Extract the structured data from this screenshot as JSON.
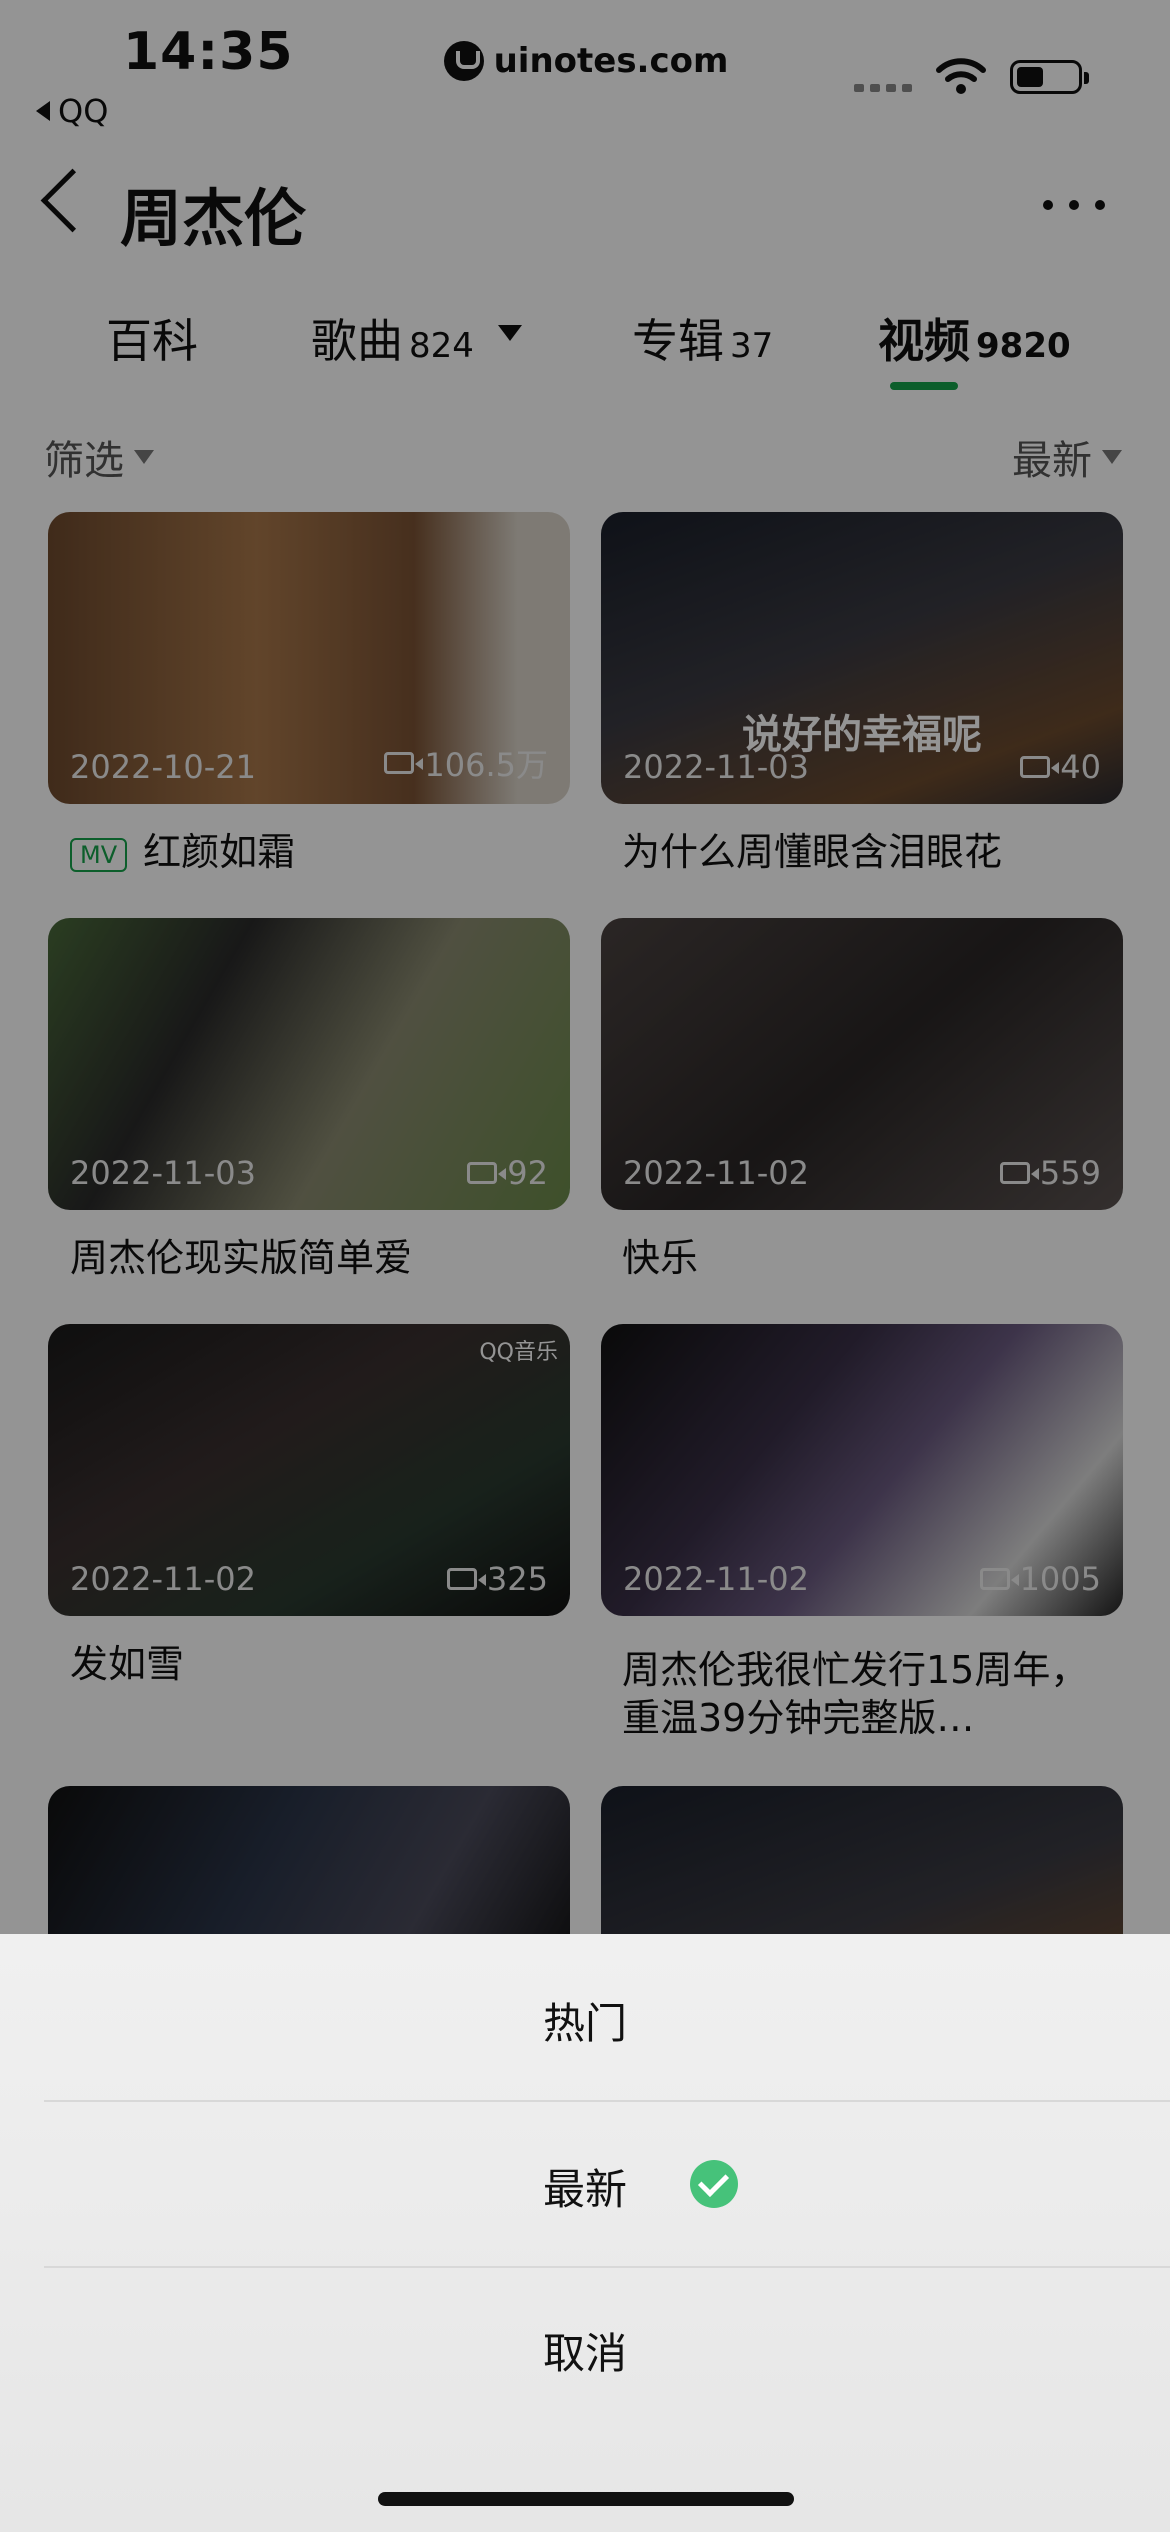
{
  "status_bar": {
    "time": "14:35",
    "back_label": "QQ",
    "url": "uinotes.com"
  },
  "header": {
    "title": "周杰伦"
  },
  "tabs": [
    {
      "label": "百科",
      "count": ""
    },
    {
      "label": "歌曲",
      "count": "824"
    },
    {
      "label": "专辑",
      "count": "37"
    },
    {
      "label": "视频",
      "count": "9820"
    }
  ],
  "filter": {
    "label": "筛选",
    "sort_label": "最新"
  },
  "videos": [
    {
      "date": "2022-10-21",
      "views": "106.5万",
      "badge": "MV",
      "title": "红颜如霜",
      "overlay": ""
    },
    {
      "date": "2022-11-03",
      "views": "40",
      "title": "为什么周懂眼含泪眼花",
      "overlay": "说好的幸福呢"
    },
    {
      "date": "2022-11-03",
      "views": "92",
      "title": "周杰伦现实版简单爱"
    },
    {
      "date": "2022-11-02",
      "views": "559",
      "title": "快乐"
    },
    {
      "date": "2022-11-02",
      "views": "325",
      "title": "发如雪",
      "badge_text": "QQ音乐"
    },
    {
      "date": "2022-11-02",
      "views": "1005",
      "title": "周杰伦我很忙发行15周年，重温39分钟完整版…"
    }
  ],
  "action_sheet": {
    "hot": "热门",
    "newest": "最新",
    "cancel": "取消"
  },
  "colors": {
    "accent": "#16a34a",
    "check": "#46c27a"
  }
}
